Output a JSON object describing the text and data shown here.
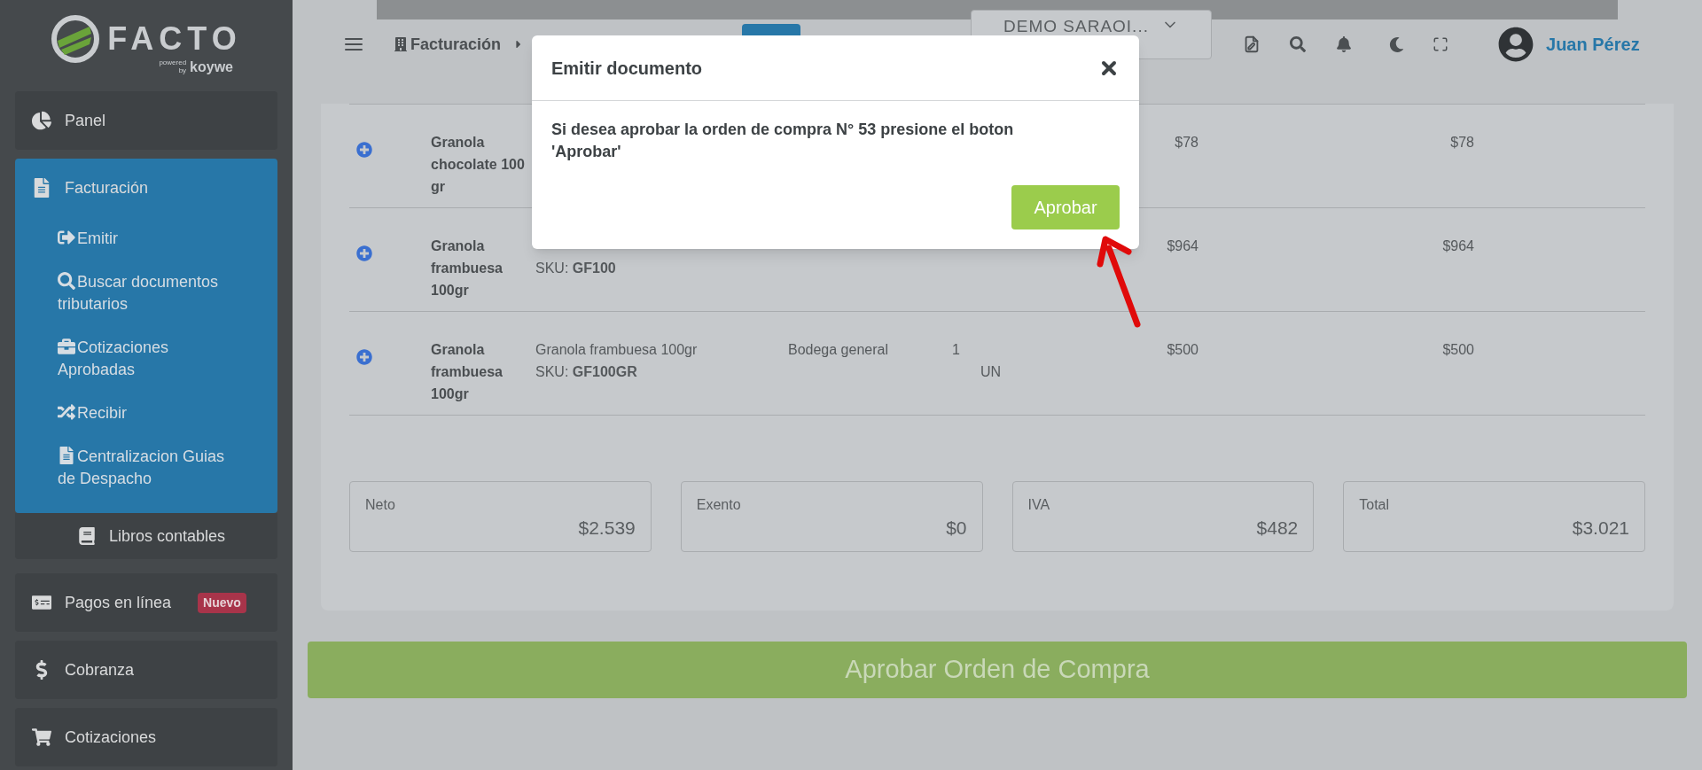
{
  "logo": {
    "name": "FACTO",
    "powered": "powered",
    "by": "by",
    "brand": "koywe"
  },
  "sidebar": {
    "items": [
      {
        "kind": "main",
        "label": "Panel",
        "selected": false
      },
      {
        "kind": "main",
        "label": "Facturación",
        "selected": true,
        "expanded": true,
        "children": [
          {
            "label": "Emitir"
          },
          {
            "label": "Buscar documentos tributarios"
          },
          {
            "label": "Cotizaciones Aprobadas"
          },
          {
            "label": "Recibir"
          },
          {
            "label": "Centralizacion Guias de Despacho"
          }
        ]
      },
      {
        "kind": "sub",
        "label": "Libros contables",
        "selected": false
      },
      {
        "kind": "main",
        "label": "Pagos en línea",
        "badge": "Nuevo",
        "selected": false
      },
      {
        "kind": "main",
        "label": "Cobranza",
        "selected": false
      },
      {
        "kind": "main",
        "label": "Cotizaciones",
        "selected": false
      }
    ]
  },
  "header": {
    "breadcrumb": "Facturación",
    "company_select": "DEMO SARAOI...",
    "user_name": "Juan Pérez"
  },
  "table": {
    "rows": [
      {
        "name": "Granola chocolate 100 gr",
        "price": "$78",
        "total": "$78"
      },
      {
        "name": "Granola frambuesa 100gr",
        "sku": "SKU: **GF100**",
        "price": "$964",
        "total": "$964"
      },
      {
        "name": "Granola frambuesa 100gr",
        "description": "Granola frambuesa 100gr",
        "sku": "SKU: **GF100GR**",
        "warehouse": "Bodega general",
        "quantity": "1",
        "unit": "UN",
        "price": "$500",
        "total": "$500"
      }
    ]
  },
  "totals": [
    {
      "label": "Neto",
      "value": "$2.539"
    },
    {
      "label": "Exento",
      "value": "$0"
    },
    {
      "label": "IVA",
      "value": "$482"
    },
    {
      "label": "Total",
      "value": "$3.021"
    }
  ],
  "approve_button": "Aprobar Orden de Compra",
  "modal": {
    "title": "Emitir documento",
    "message": "Si desea aprobar la orden de compra N° 53 presione el boton 'Aprobar'",
    "confirm": "Aprobar"
  }
}
